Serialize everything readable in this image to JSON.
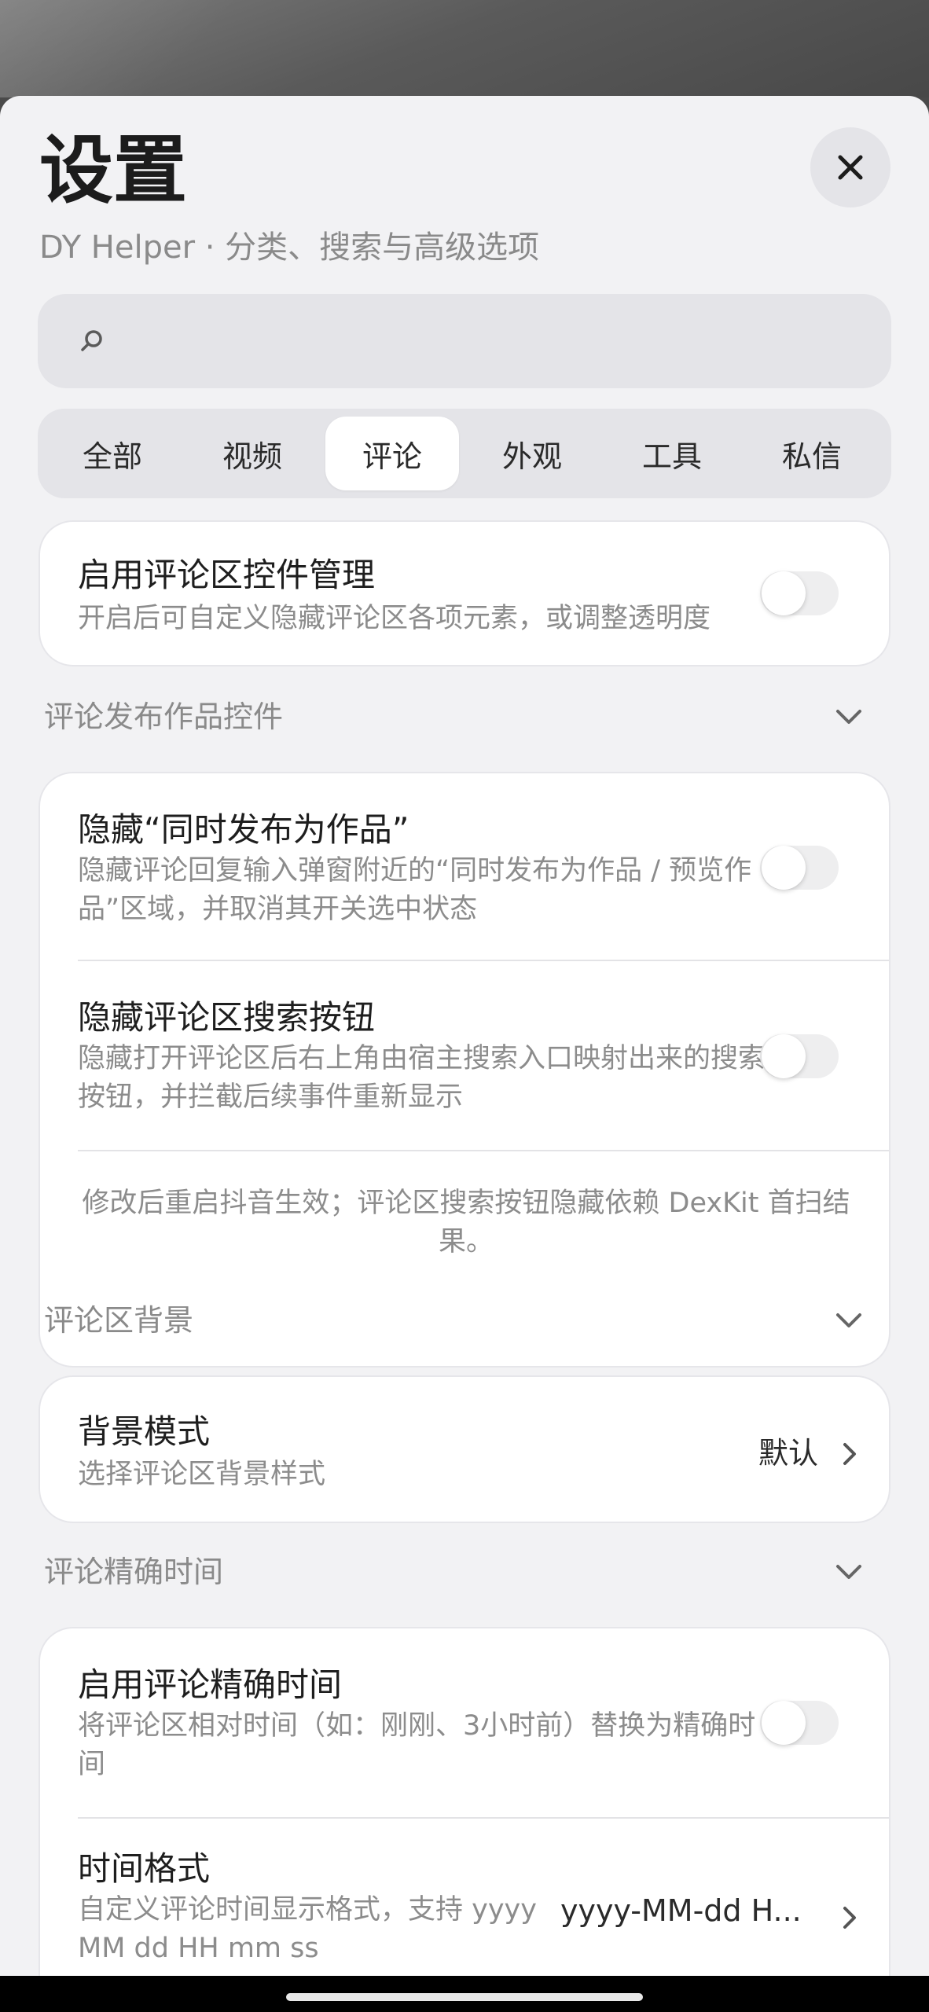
{
  "header": {
    "title": "设置",
    "subtitle": "DY Helper · 分类、搜索与高级选项"
  },
  "search": {
    "value": "",
    "placeholder": ""
  },
  "tabs": [
    {
      "label": "全部",
      "active": false
    },
    {
      "label": "视频",
      "active": false
    },
    {
      "label": "评论",
      "active": true
    },
    {
      "label": "外观",
      "active": false
    },
    {
      "label": "工具",
      "active": false
    },
    {
      "label": "私信",
      "active": false
    }
  ],
  "master": {
    "title": "启用评论区控件管理",
    "desc": "开启后可自定义隐藏评论区各项元素，或调整透明度",
    "enabled": false
  },
  "sections": [
    {
      "header": "评论发布作品控件",
      "items": [
        {
          "title": "隐藏“同时发布为作品”",
          "desc": "隐藏评论回复输入弹窗附近的“同时发布为作品 / 预览作品”区域，并取消其开关选中状态",
          "enabled": false
        },
        {
          "title": "隐藏评论区搜索按钮",
          "desc": "隐藏打开评论区后右上角由宿主搜索入口映射出来的搜索按钮，并拦截后续事件重新显示",
          "enabled": false
        }
      ],
      "note": "修改后重启抖音生效；评论区搜索按钮隐藏依赖 DexKit 首扫结果。"
    },
    {
      "header": "评论区背景",
      "items": [
        {
          "title": "背景模式",
          "desc": "选择评论区背景样式",
          "value": "默认"
        }
      ]
    },
    {
      "header": "评论精确时间",
      "items": [
        {
          "title": "启用评论精确时间",
          "desc": "将评论区相对时间（如：刚刚、3小时前）替换为精确时间",
          "enabled": false
        },
        {
          "title": "时间格式",
          "desc": "自定义评论时间显示格式，支持 yyyy MM dd HH mm ss",
          "value": "yyyy-MM-dd H..."
        }
      ]
    }
  ],
  "colors": {
    "sheet_bg": "#f2f2f4",
    "card_bg": "#ffffff",
    "toggle_off": "#eeeeef",
    "muted_text": "#8c8c8c"
  }
}
